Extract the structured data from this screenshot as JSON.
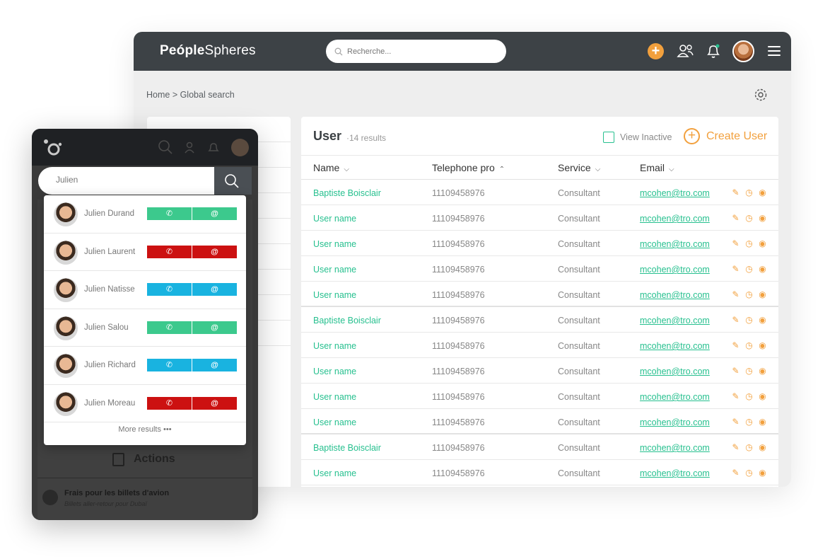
{
  "app": {
    "logo_a": "Peóple",
    "logo_b": "Spheres",
    "search_placeholder": "Recherche...",
    "plus_label": "+",
    "breadcrumb": "Home > Global search"
  },
  "user_panel": {
    "title": "User",
    "count": "·14 results",
    "view_inactive": "View Inactive",
    "create_icon": "+",
    "create_label": "Create User",
    "columns": [
      "Name",
      "Telephone pro",
      "Service",
      "Email"
    ],
    "sort_glyphs": [
      "⌵",
      "⌃",
      "⌵",
      "⌵"
    ],
    "rows": [
      {
        "name": "Baptiste Boisclair",
        "tel": "11109458976",
        "service": "Consultant",
        "email": "mcohen@tro.com"
      },
      {
        "name": "User name",
        "tel": "11109458976",
        "service": "Consultant",
        "email": "mcohen@tro.com"
      },
      {
        "name": "User name",
        "tel": "11109458976",
        "service": "Consultant",
        "email": "mcohen@tro.com"
      },
      {
        "name": "User name",
        "tel": "11109458976",
        "service": "Consultant",
        "email": "mcohen@tro.com"
      },
      {
        "name": "User name",
        "tel": "11109458976",
        "service": "Consultant",
        "email": "mcohen@tro.com"
      },
      {
        "name": "Baptiste Boisclair",
        "tel": "11109458976",
        "service": "Consultant",
        "email": "mcohen@tro.com"
      },
      {
        "name": "User name",
        "tel": "11109458976",
        "service": "Consultant",
        "email": "mcohen@tro.com"
      },
      {
        "name": "User name",
        "tel": "11109458976",
        "service": "Consultant",
        "email": "mcohen@tro.com"
      },
      {
        "name": "User name",
        "tel": "11109458976",
        "service": "Consultant",
        "email": "mcohen@tro.com"
      },
      {
        "name": "User name",
        "tel": "11109458976",
        "service": "Consultant",
        "email": "mcohen@tro.com"
      },
      {
        "name": "Baptiste Boisclair",
        "tel": "11109458976",
        "service": "Consultant",
        "email": "mcohen@tro.com"
      },
      {
        "name": "User name",
        "tel": "11109458976",
        "service": "Consultant",
        "email": "mcohen@tro.com"
      }
    ],
    "row_action_icons": [
      "edit-icon",
      "history-icon",
      "view-icon"
    ]
  },
  "mobile": {
    "search_value": "Julien",
    "results": [
      {
        "name": "Julien Durand",
        "color": "#3cc98d"
      },
      {
        "name": "Julien Laurent",
        "color": "#cc1111"
      },
      {
        "name": "Julien Natisse",
        "color": "#19b3e0"
      },
      {
        "name": "Julien Salou",
        "color": "#3cc98d"
      },
      {
        "name": "Julien Richard",
        "color": "#19b3e0"
      },
      {
        "name": "Julien Moreau",
        "color": "#cc1111"
      }
    ],
    "call_glyph": "✆",
    "mail_glyph": "@",
    "more_results": "More results  •••",
    "actions_label": "Actions",
    "frais_title": "Frais pour les billets d'avion",
    "frais_sub": "Billets aller-retour pour Dubaï"
  },
  "colors": {
    "accent_green": "#27c08f",
    "accent_orange": "#f2a03d",
    "topbar": "#3d4246"
  }
}
